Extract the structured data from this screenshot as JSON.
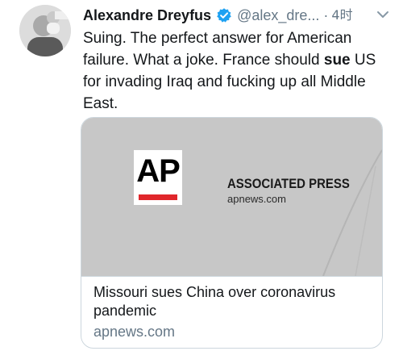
{
  "tweet": {
    "display_name": "Alexandre Dreyfus",
    "handle": "@alex_dre...",
    "separator": "·",
    "timestamp": "4时",
    "verified_icon": "verified-badge-icon",
    "menu_icon": "chevron-down-icon",
    "text_before": "Suing. The perfect answer for American failure. What a joke. France should ",
    "text_bold": "sue",
    "text_after": " US for invading Iraq and fucking up all Middle East."
  },
  "card": {
    "logo_text": "AP",
    "publisher_name": "ASSOCIATED PRESS",
    "publisher_domain": "apnews.com",
    "title": "Missouri sues China over coronavirus pandemic",
    "domain": "apnews.com"
  },
  "colors": {
    "verified": "#1da1f2",
    "secondary_text": "#657786",
    "card_image_bg": "#c7c7c7",
    "ap_red": "#e0262b"
  }
}
